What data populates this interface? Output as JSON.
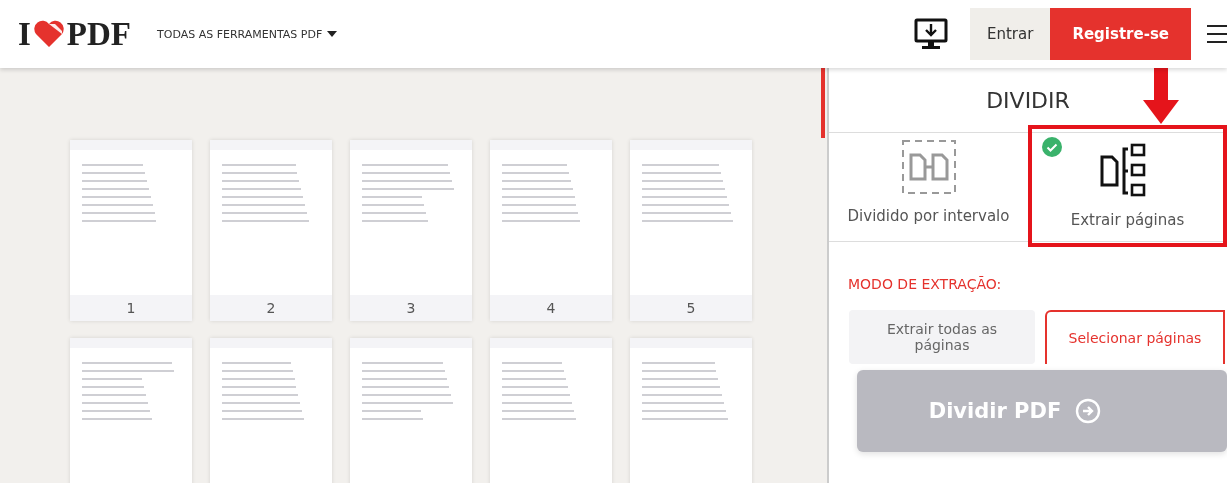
{
  "header": {
    "logo_left": "I",
    "logo_right": "PDF",
    "nav_menu": "TODAS AS FERRAMENTAS PDF",
    "login": "Entrar",
    "signup": "Registre-se"
  },
  "pages": [
    {
      "kind": "full",
      "number": "1"
    },
    {
      "kind": "full",
      "number": "2"
    },
    {
      "kind": "full",
      "number": "3"
    },
    {
      "kind": "full",
      "number": "4"
    },
    {
      "kind": "full",
      "number": "5"
    },
    {
      "kind": "cut-off"
    },
    {
      "kind": "cut-off"
    },
    {
      "kind": "cut-off"
    },
    {
      "kind": "cut-off"
    },
    {
      "kind": "cut-off"
    }
  ],
  "panel": {
    "title": "DIVIDIR",
    "options": [
      {
        "label": "Dividido por intervalo",
        "kind": "range",
        "selected": false
      },
      {
        "label": "Extrair páginas",
        "kind": "extract",
        "selected": true
      }
    ],
    "section_label": "MODO DE EXTRAÇÃO:",
    "modes": [
      {
        "label": "Extrair todas as páginas",
        "selected": false
      },
      {
        "label": "Selecionar páginas",
        "selected": true
      }
    ],
    "action": "Dividir PDF"
  }
}
